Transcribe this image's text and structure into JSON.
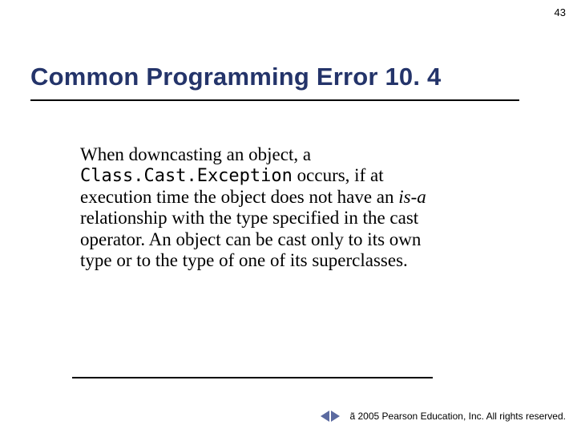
{
  "page_number": "43",
  "heading": "Common Programming Error 10. 4",
  "body": {
    "part1": "When downcasting an object, a ",
    "code": "Class.Cast.Exception",
    "part2": " occurs, if at execution time the object does not have an ",
    "isa": "is-a",
    "part3": "  relationship with the type specified in the cast operator. An object can be cast only to its own type or to the type of one of its superclasses."
  },
  "footer": {
    "copyright_symbol": "ã",
    "text": " 2005 Pearson Education, Inc. All rights reserved."
  },
  "nav": {
    "prev": "previous-slide",
    "next": "next-slide"
  }
}
